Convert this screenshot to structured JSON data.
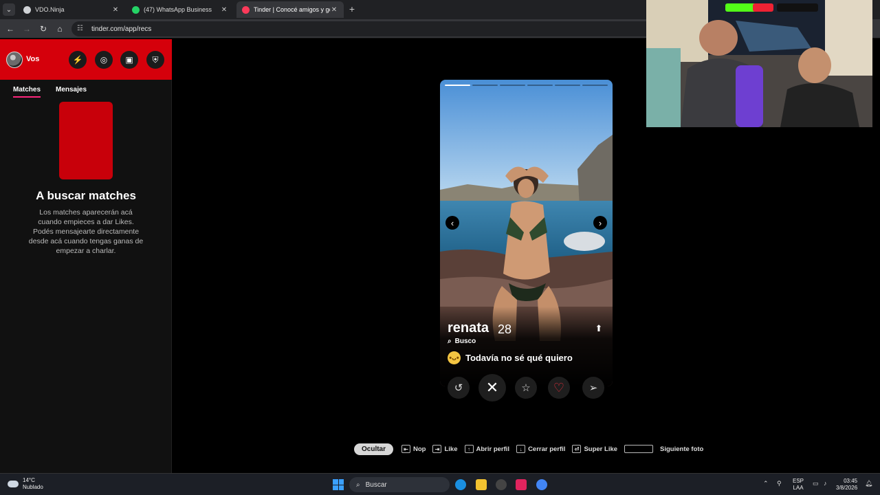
{
  "browser": {
    "tabs": [
      {
        "title": "VDO.Ninja",
        "favicon_color": "#cfd2d6"
      },
      {
        "title": "(47) WhatsApp Business",
        "favicon_color": "#25d366"
      },
      {
        "title": "Tinder | Conocé amigos y gente",
        "favicon_color": "#fd3a5a"
      }
    ],
    "url": "tinder.com/app/recs"
  },
  "sidebar": {
    "user_label": "Vos",
    "tabs": [
      "Matches",
      "Mensajes"
    ],
    "empty_title": "A buscar matches",
    "empty_desc": "Los matches aparecerán acá cuando empieces a dar Likes. Podés mensajearte directamente desde acá cuando tengas ganas de empezar a charlar."
  },
  "profile": {
    "name": "renata",
    "age": "28",
    "looking_label": "Busco",
    "goal": "Todavía no sé qué quiero",
    "photo_count": 6,
    "current_photo": 1
  },
  "hints": {
    "hide": "Ocultar",
    "nope": "Nop",
    "like": "Like",
    "open": "Abrir perfil",
    "close": "Cerrar perfil",
    "superlike": "Super Like",
    "next": "Siguiente foto"
  },
  "taskbar": {
    "temp": "14°C",
    "weather": "Nublado",
    "search": "Buscar",
    "lang1": "ESP",
    "lang2": "LAA",
    "time": "03:45",
    "date": "3/8/2026"
  },
  "colors": {
    "tinder_red": "#d5000b",
    "like_red": "#e0303c",
    "tab_underline": "#fd267d"
  }
}
